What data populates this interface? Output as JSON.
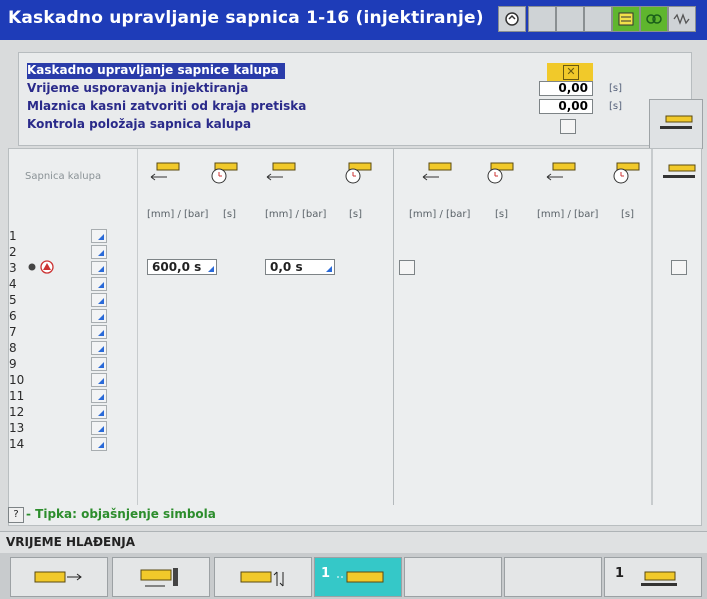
{
  "window": {
    "title": "Kaskadno upravljanje sapnica 1-16 (injektiranje)"
  },
  "colors": {
    "titlebar": "#1e3cb8",
    "accent_yellow": "#f1c92a",
    "active_button": "#35c8c8",
    "hint_green": "#2c8d2c",
    "triangle_blue": "#2a6ad8"
  },
  "settings": {
    "rows": [
      {
        "label": "Kaskadno upravljanje sapnice kalupa",
        "value": "",
        "unit": ""
      },
      {
        "label": "Vrijeme usporavanja injektiranja",
        "value": "0,00",
        "unit": "[s]"
      },
      {
        "label": "Mlaznica  kasni zatvoriti od kraja pretiska",
        "value": "0,00",
        "unit": "[s]"
      },
      {
        "label": "Kontrola položaja sapnica kalupa",
        "value": "",
        "unit": ""
      }
    ]
  },
  "table": {
    "row_header": "Sapnica kalupa",
    "column_units": [
      "[mm] / [bar]",
      "[s]",
      "[mm] / [bar]",
      "[s]",
      "[mm] / [bar]",
      "[s]",
      "[mm] / [bar]",
      "[s]"
    ],
    "rows": [
      "1",
      "2",
      "3",
      "4",
      "5",
      "6",
      "7",
      "8",
      "9",
      "10",
      "11",
      "12",
      "13",
      "14"
    ],
    "values": {
      "row3_col1": "600,0",
      "row3_col1_unit": "s",
      "row3_col3": "0,0",
      "row3_col3_unit": "s"
    }
  },
  "hint": {
    "key": "?",
    "text": "- Tipka: objašnjenje simbola"
  },
  "status": {
    "label": "VRIJEME HLAĐENJA"
  },
  "bottom": {
    "buttons": [
      {
        "name": "injection-forward"
      },
      {
        "name": "mold-nozzle-move"
      },
      {
        "name": "nozzle-up-down"
      },
      {
        "name": "cascade-1",
        "number": "1",
        "active": true
      },
      {
        "name": "empty-1"
      },
      {
        "name": "empty-2"
      },
      {
        "name": "page-1",
        "number": "1"
      }
    ]
  },
  "icons": [
    "sequence-icon",
    "green-status-icon",
    "signal-icon",
    "nozzle-icon",
    "timer-icon"
  ]
}
